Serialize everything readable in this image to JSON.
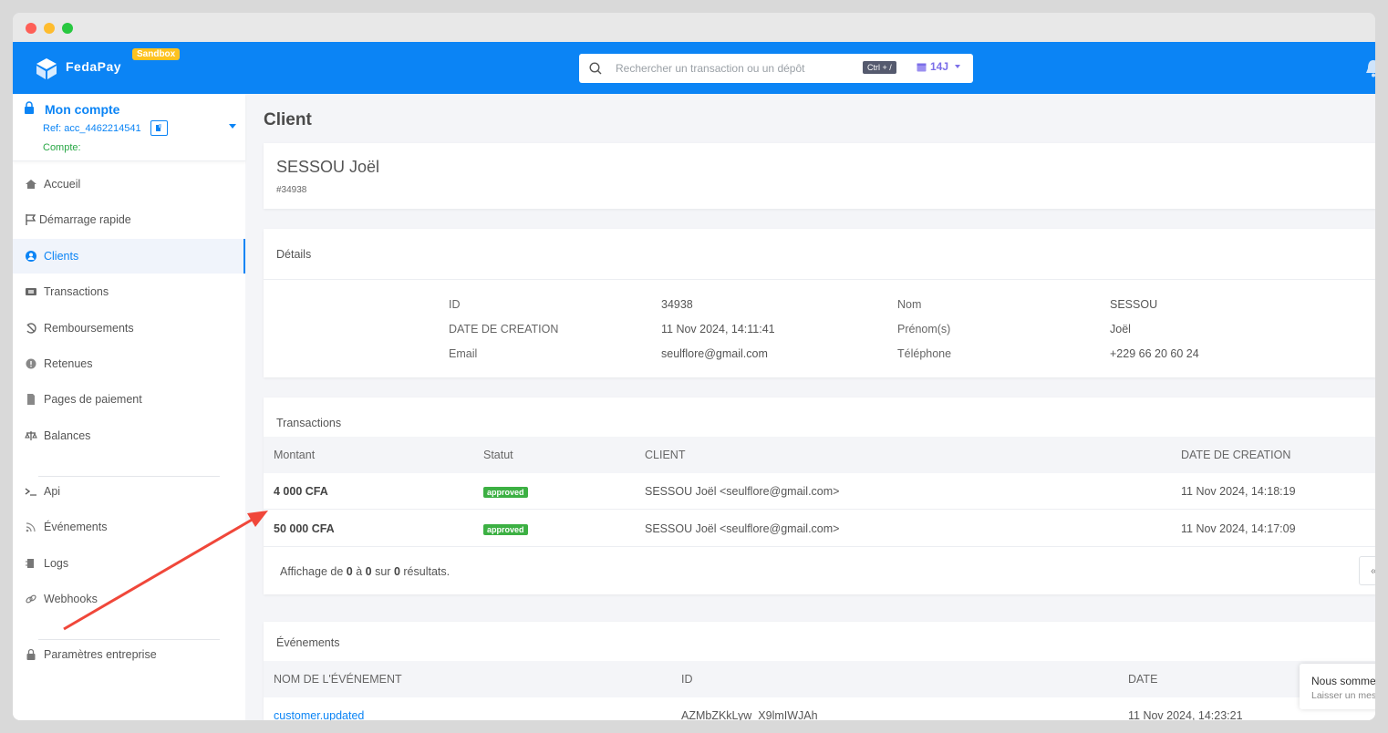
{
  "brand": {
    "name": "FedaPay",
    "env_badge": "Sandbox"
  },
  "search": {
    "placeholder": "Rechercher un transaction ou un dépôt",
    "shortcut": "Ctrl + /",
    "period": "14J"
  },
  "account": {
    "title": "Mon compte",
    "ref": "Ref: acc_4462214541",
    "compte_label": "Compte:"
  },
  "nav": {
    "accueil": "Accueil",
    "demarrage": "Démarrage rapide",
    "clients": "Clients",
    "transactions": "Transactions",
    "remboursements": "Remboursements",
    "retenues": "Retenues",
    "pages": "Pages de paiement",
    "balances": "Balances",
    "api": "Api",
    "evenements": "Événements",
    "logs": "Logs",
    "webhooks": "Webhooks",
    "parametres": "Paramètres entreprise"
  },
  "page": {
    "title": "Client"
  },
  "client": {
    "name": "SESSOU Joël",
    "number": "#34938"
  },
  "details": {
    "heading": "Détails",
    "id_label": "ID",
    "id_value": "34938",
    "date_label": "DATE DE CREATION",
    "date_value": "11 Nov 2024, 14:11:41",
    "email_label": "Email",
    "email_value": "seulflore@gmail.com",
    "nom_label": "Nom",
    "nom_value": "SESSOU",
    "prenom_label": "Prénom(s)",
    "prenom_value": "Joël",
    "tel_label": "Téléphone",
    "tel_value": "+229 66 20 60 24"
  },
  "transactions": {
    "heading": "Transactions",
    "columns": {
      "montant": "Montant",
      "statut": "Statut",
      "client": "CLIENT",
      "date": "DATE DE CREATION"
    },
    "rows": [
      {
        "amount": "4 000 CFA",
        "status": "approved",
        "client": "SESSOU Joël <seulflore@gmail.com>",
        "date": "11 Nov 2024, 14:18:19"
      },
      {
        "amount": "50 000 CFA",
        "status": "approved",
        "client": "SESSOU Joël <seulflore@gmail.com>",
        "date": "11 Nov 2024, 14:17:09"
      }
    ],
    "pager": {
      "prefix": "Affichage de",
      "from": "0",
      "to_word": "à",
      "to": "0",
      "of_word": "sur",
      "total": "0",
      "suffix": "résultats.",
      "prev_glyph": "«"
    }
  },
  "events": {
    "heading": "Événements",
    "columns": {
      "name": "NOM DE L'ÉVÉNEMENT",
      "id": "ID",
      "date": "DATE"
    },
    "rows": [
      {
        "name": "customer.updated",
        "id": "AZMbZKkLyw_X9lmIWJAh",
        "date": "11 Nov 2024, 14:23:21"
      }
    ]
  },
  "chat": {
    "title": "Nous sommes",
    "subtitle": "Laisser un message"
  },
  "colors": {
    "primary": "#0b84f5",
    "sandbox": "#fdc220",
    "approved": "#3cb043",
    "annotation_arrow": "#f0473a"
  },
  "icons": [
    "logo-icon",
    "search-icon",
    "calendar-icon",
    "bell-icon",
    "lock-icon",
    "copy-icon",
    "home-icon",
    "flag-icon",
    "user-circle-icon",
    "card-icon",
    "refund-icon",
    "alert-icon",
    "page-icon",
    "balance-icon",
    "terminal-icon",
    "rss-icon",
    "logs-icon",
    "link-icon"
  ]
}
